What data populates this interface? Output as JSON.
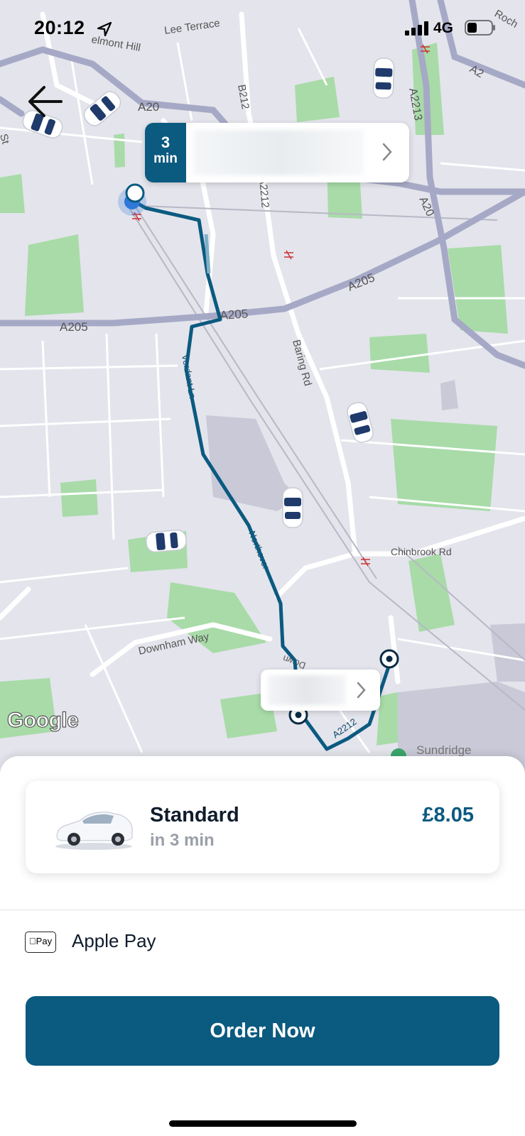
{
  "status_bar": {
    "time": "20:12",
    "network": "4G"
  },
  "map": {
    "road_labels": {
      "lee_terrace": "Lee Terrace",
      "belmont_hill": "elmont Hill",
      "a20_top": "A20",
      "b212": "B212",
      "a2212_top": "A2212",
      "a2213": "A2213",
      "a20_right": "A20",
      "a2": "A2",
      "rochester": "Roch",
      "st": "St",
      "a205_left": "A205",
      "a205_center": "A205",
      "a205_right": "A205",
      "baring_rd": "Baring Rd",
      "verdant_ln": "Verdant Ln",
      "northover": "Northover",
      "chinbrook_rd": "Chinbrook Rd",
      "downham_way": "Downham Way",
      "downham_route": "Down",
      "a2212_bottom": "A2212",
      "sundridge": "Sundridge"
    },
    "google_logo": "Google",
    "colors": {
      "route": "#0b5a80",
      "park": "#a8dba8",
      "road_major": "#a6a9c6",
      "road_minor": "#ffffff",
      "background": "#e4e4ec"
    }
  },
  "eta_card": {
    "time_value": "3",
    "time_unit": "min"
  },
  "ride_option": {
    "name": "Standard",
    "eta": "in 3 min",
    "price": "£8.05"
  },
  "payment": {
    "icon_text": "Pay",
    "label": "Apple Pay"
  },
  "order_button": {
    "label": "Order Now"
  },
  "icons": {
    "back": "back-arrow-icon",
    "navigation": "location-arrow-icon",
    "signal": "signal-bars-icon",
    "battery": "battery-icon",
    "chevron": "chevron-right-icon"
  }
}
